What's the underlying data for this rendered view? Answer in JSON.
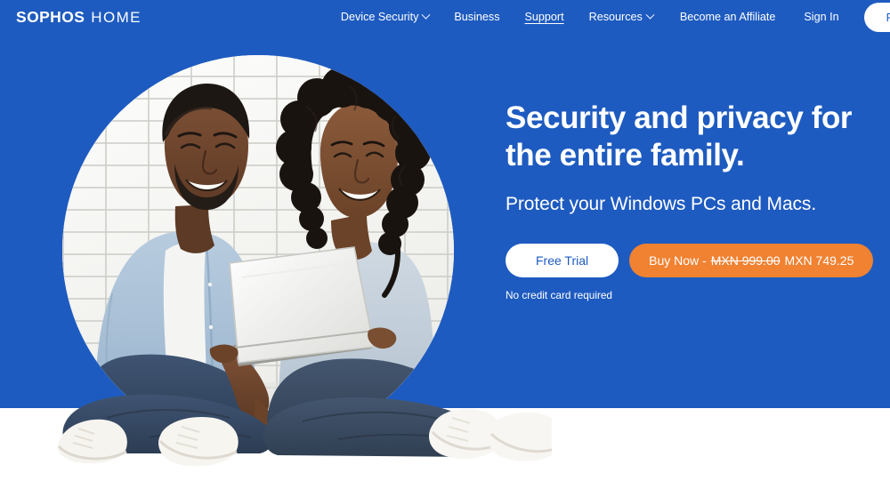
{
  "brand": {
    "logo_mark": "SOPHOS",
    "logo_sub": "HOME"
  },
  "nav": {
    "items": [
      {
        "label": "Device Security",
        "has_dropdown": true,
        "active": false
      },
      {
        "label": "Business",
        "has_dropdown": false,
        "active": false
      },
      {
        "label": "Support",
        "has_dropdown": false,
        "active": true
      },
      {
        "label": "Resources",
        "has_dropdown": true,
        "active": false
      }
    ],
    "right_items": [
      {
        "label": "Become an Affiliate"
      },
      {
        "label": "Sign In"
      }
    ],
    "cta_label": "Free Trial"
  },
  "hero": {
    "headline_line1": "Security and privacy for",
    "headline_line2": "the entire family.",
    "subhead": "Protect your Windows PCs and Macs.",
    "trial_button": "Free Trial",
    "buy_prefix": "Buy Now -",
    "price_old": "MXN 999.00",
    "price_new": "MXN 749.25",
    "note": "No credit card required",
    "image_alt": "Smiling couple sitting on the floor against a white brick wall looking at a laptop"
  },
  "colors": {
    "hero_blue": "#1e5bc0",
    "accent_orange": "#f08232",
    "white": "#ffffff",
    "page_background": "#ffffff"
  }
}
